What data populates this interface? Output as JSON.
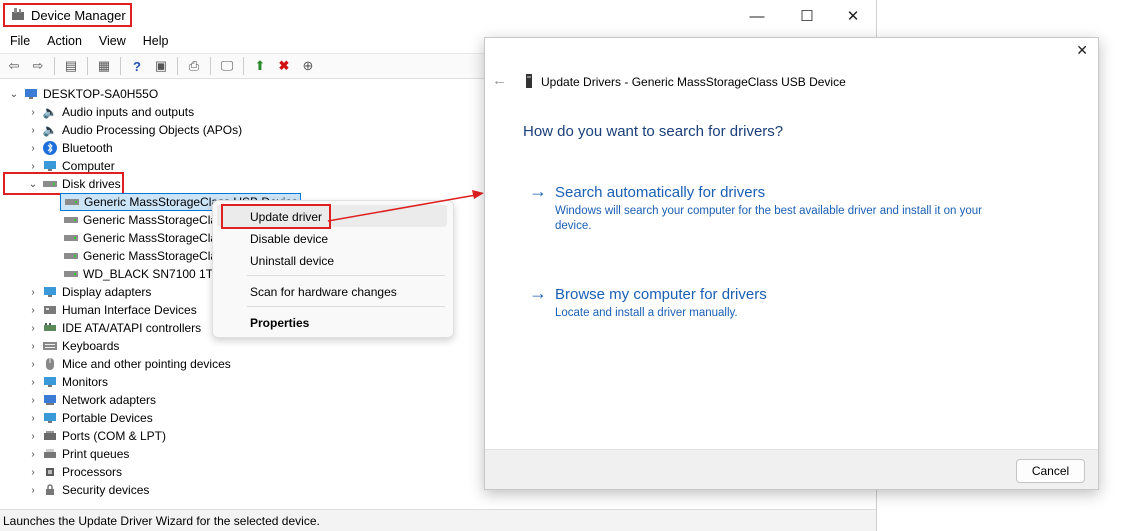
{
  "window": {
    "title": "Device Manager",
    "controls": {
      "minimize": "—",
      "maximize": "☐",
      "close": "✕"
    }
  },
  "menu": [
    "File",
    "Action",
    "View",
    "Help"
  ],
  "tree": {
    "root": "DESKTOP-SA0H55O",
    "items": [
      {
        "label": "Audio inputs and outputs",
        "icon": "speaker-icon"
      },
      {
        "label": "Audio Processing Objects (APOs)",
        "icon": "speaker-icon"
      },
      {
        "label": "Bluetooth",
        "icon": "bluetooth-icon"
      },
      {
        "label": "Computer",
        "icon": "monitor-icon"
      },
      {
        "label": "Disk drives",
        "icon": "disk-drive-icon",
        "expanded": true
      },
      {
        "label": "Display adapters",
        "icon": "display-adapter-icon"
      },
      {
        "label": "Human Interface Devices",
        "icon": "hid-icon"
      },
      {
        "label": "IDE ATA/ATAPI controllers",
        "icon": "ide-icon"
      },
      {
        "label": "Keyboards",
        "icon": "keyboard-icon"
      },
      {
        "label": "Mice and other pointing devices",
        "icon": "mouse-icon"
      },
      {
        "label": "Monitors",
        "icon": "monitor-icon"
      },
      {
        "label": "Network adapters",
        "icon": "network-icon"
      },
      {
        "label": "Portable Devices",
        "icon": "portable-device-icon"
      },
      {
        "label": "Ports (COM & LPT)",
        "icon": "port-icon"
      },
      {
        "label": "Print queues",
        "icon": "printer-icon"
      },
      {
        "label": "Processors",
        "icon": "processor-icon"
      },
      {
        "label": "Security devices",
        "icon": "security-icon"
      }
    ],
    "disk_children": [
      "Generic MassStorageClass USB Device",
      "Generic MassStorageCla",
      "Generic MassStorageCla",
      "Generic MassStorageCla",
      "WD_BLACK SN7100 1TB"
    ]
  },
  "context_menu": {
    "update": "Update driver",
    "disable": "Disable device",
    "uninstall": "Uninstall device",
    "scan": "Scan for hardware changes",
    "properties": "Properties"
  },
  "status": "Launches the Update Driver Wizard for the selected device.",
  "dialog": {
    "header": "Update Drivers - Generic MassStorageClass USB Device",
    "question": "How do you want to search for drivers?",
    "option1_title": "Search automatically for drivers",
    "option1_desc": "Windows will search your computer for the best available driver and install it on your device.",
    "option2_title": "Browse my computer for drivers",
    "option2_desc": "Locate and install a driver manually.",
    "cancel": "Cancel",
    "close": "✕",
    "back": "←"
  },
  "colors": {
    "accent": "#1a5fb4",
    "highlight": "#e02020",
    "selection": "#cce4f7"
  }
}
